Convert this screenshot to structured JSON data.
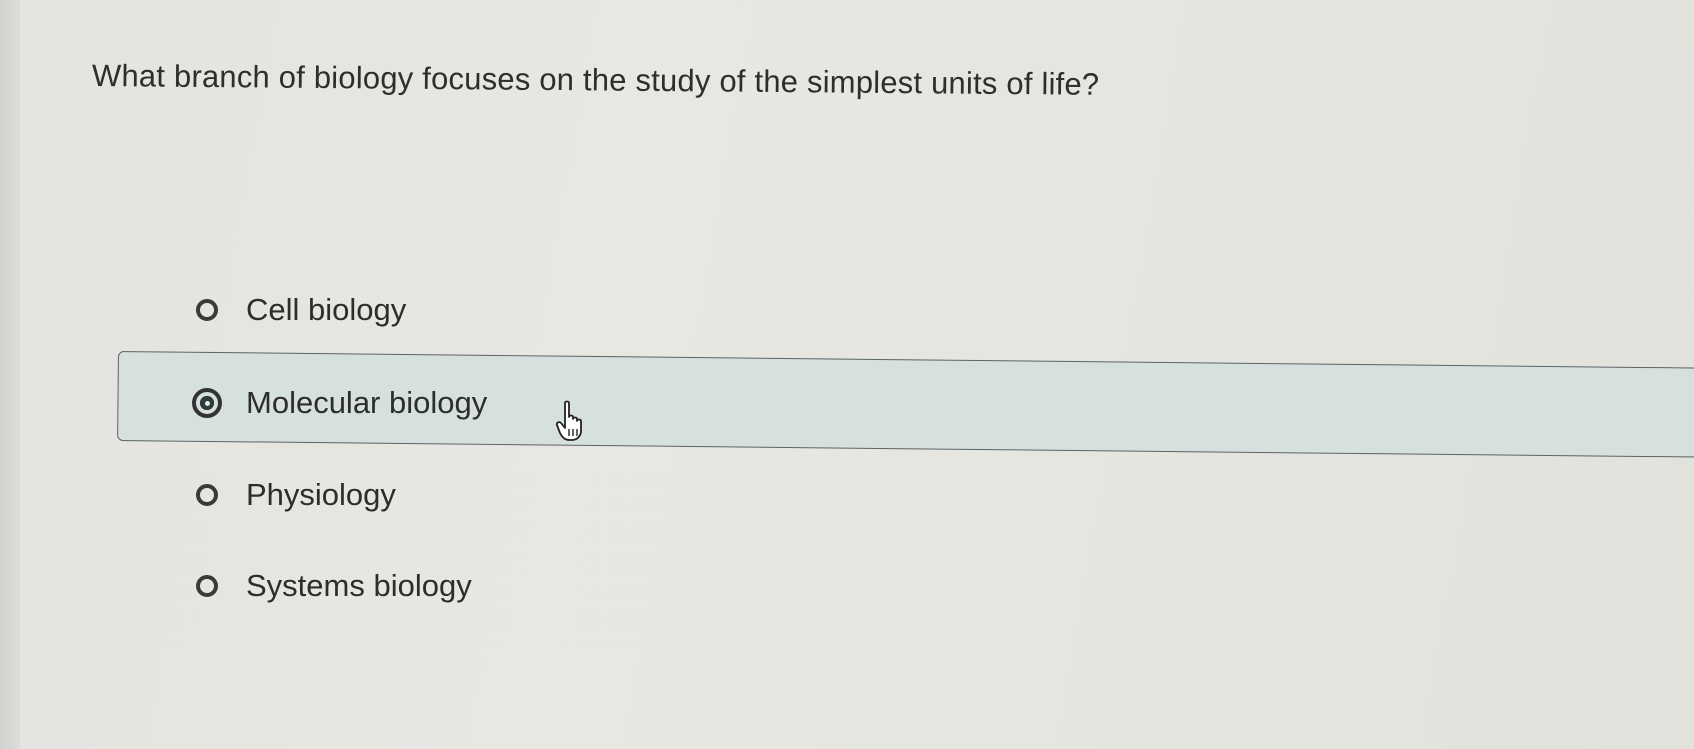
{
  "question": {
    "text": "What branch of biology focuses on the study of the simplest units of life?"
  },
  "options": [
    {
      "label": "Cell biology",
      "selected": false
    },
    {
      "label": "Molecular biology",
      "selected": true
    },
    {
      "label": "Physiology",
      "selected": false
    },
    {
      "label": "Systems biology",
      "selected": false
    }
  ],
  "colors": {
    "selected_background": "#d6e0dc",
    "radio_border": "#3a3a3a",
    "text": "#2d2d2d"
  },
  "cursor": {
    "icon": "hand-pointer-icon"
  }
}
